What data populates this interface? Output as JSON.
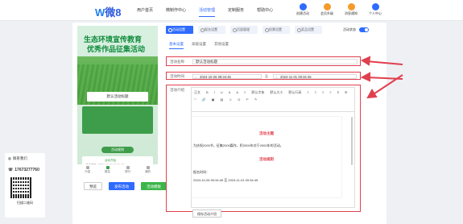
{
  "logo": {
    "w": "W",
    "text": "微8"
  },
  "nav": [
    "用户首页",
    "微制作中心",
    "活动管理",
    "定制服务",
    "帮助中心"
  ],
  "top_icons": [
    {
      "label": "创建活动",
      "icon": "plus-icon",
      "color": "#2f6bff"
    },
    {
      "label": "会员升级",
      "icon": "crown-icon",
      "color": "#f59b2b"
    },
    {
      "label": "消息通知",
      "icon": "bell-icon",
      "color": "#f59b2b"
    },
    {
      "label": "个人中心",
      "icon": "user-icon",
      "color": "#2f6bff"
    }
  ],
  "left_panel": {
    "contact": "联系我们",
    "phone": "17673277760",
    "qr_label": "扫描二维码"
  },
  "preview": {
    "title1": "生态环境宣传教育",
    "title2": "优秀作品征集活动",
    "name": "默认活动标题",
    "rules": "活动规则",
    "box_sub": "活动开始",
    "line1": "活动开始: 2024-10-26 09:34:45",
    "line2": "活动截止: 2024-11-01 09:34:45",
    "tabs": [
      "介绍",
      "报名",
      "排行",
      "我的"
    ]
  },
  "buttons": {
    "preview": "预览",
    "publish": "发布活动",
    "save": "活动模板"
  },
  "steps": [
    "活动设置",
    "报名设置",
    "页面管理",
    "投票设置",
    "奖品设置"
  ],
  "toggle_label": "活动状态",
  "subtabs": [
    "基本设置",
    "高级设置",
    "其他设置"
  ],
  "form": {
    "name_label": "活动名称",
    "name_value": "默认活动标题",
    "time_label": "活动时间",
    "start": "2024-10-26 09:34:45",
    "sep": "至",
    "end": "2024-11-01 09:34:45",
    "desc_label": "活动介绍"
  },
  "toolbar": [
    "正文",
    "B",
    "I",
    "U",
    "A",
    "A",
    "≡",
    "默认字体",
    "默认大小",
    "默认行高",
    "≡",
    "≡",
    "≡",
    "≡",
    "¶",
    "☰",
    "“”",
    "🔗",
    "▣",
    "▤",
    "☺",
    "Ω",
    "↶",
    "↷"
  ],
  "content": {
    "title1": "活动主题",
    "text1": "为庆祝2000节，征集2000篇作，积2000年对于2000年的活动。",
    "title2": "活动规则",
    "text2": "报名时间：",
    "text3": "2024-10-26 09:34:45 至 2024-11-01 09:34:45"
  },
  "save_template": "保存活动介绍",
  "colors": {
    "accent": "#2f6bff",
    "highlight": "#e0404e",
    "green": "#3cb64a"
  }
}
